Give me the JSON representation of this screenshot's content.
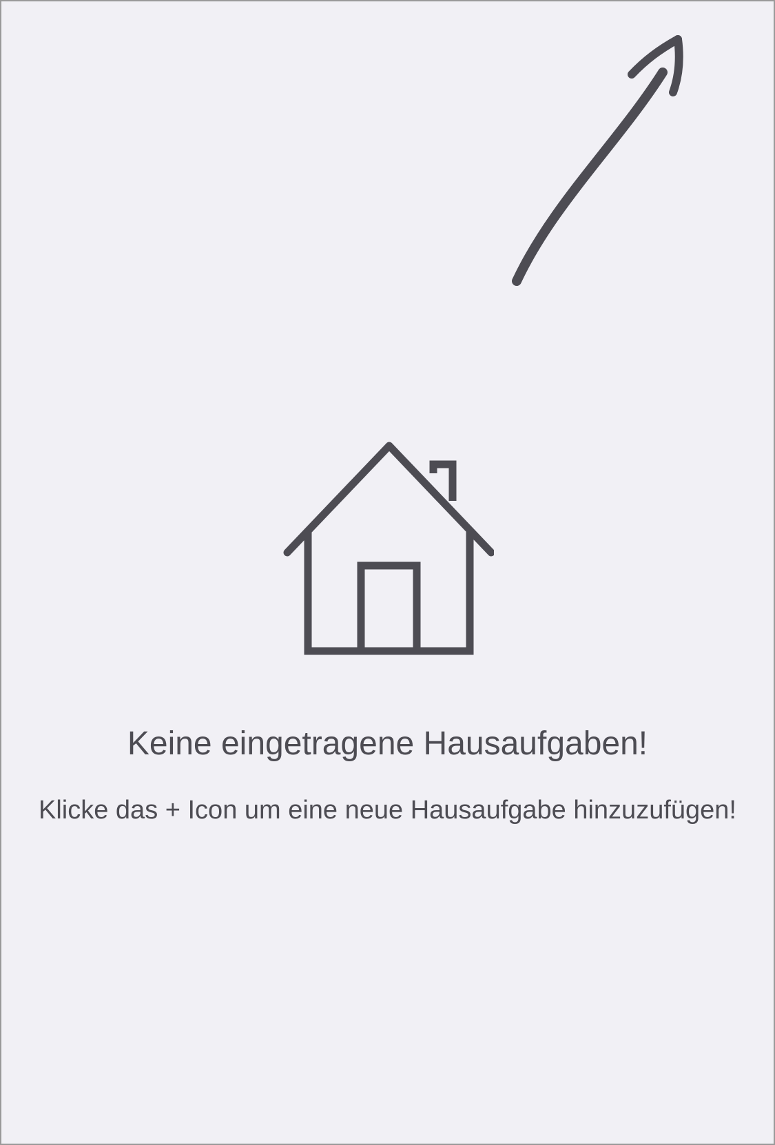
{
  "empty_state": {
    "icon": "house-icon",
    "title": "Keine eingetragene Hausaufgaben!",
    "subtitle": "Klicke das + Icon um eine neue Hausaufgabe hinzuzufügen!"
  },
  "hint": {
    "icon": "arrow-up-right-icon"
  },
  "colors": {
    "background": "#f1f0f5",
    "ink": "#4d4c53",
    "frame": "#9a9a9a"
  }
}
